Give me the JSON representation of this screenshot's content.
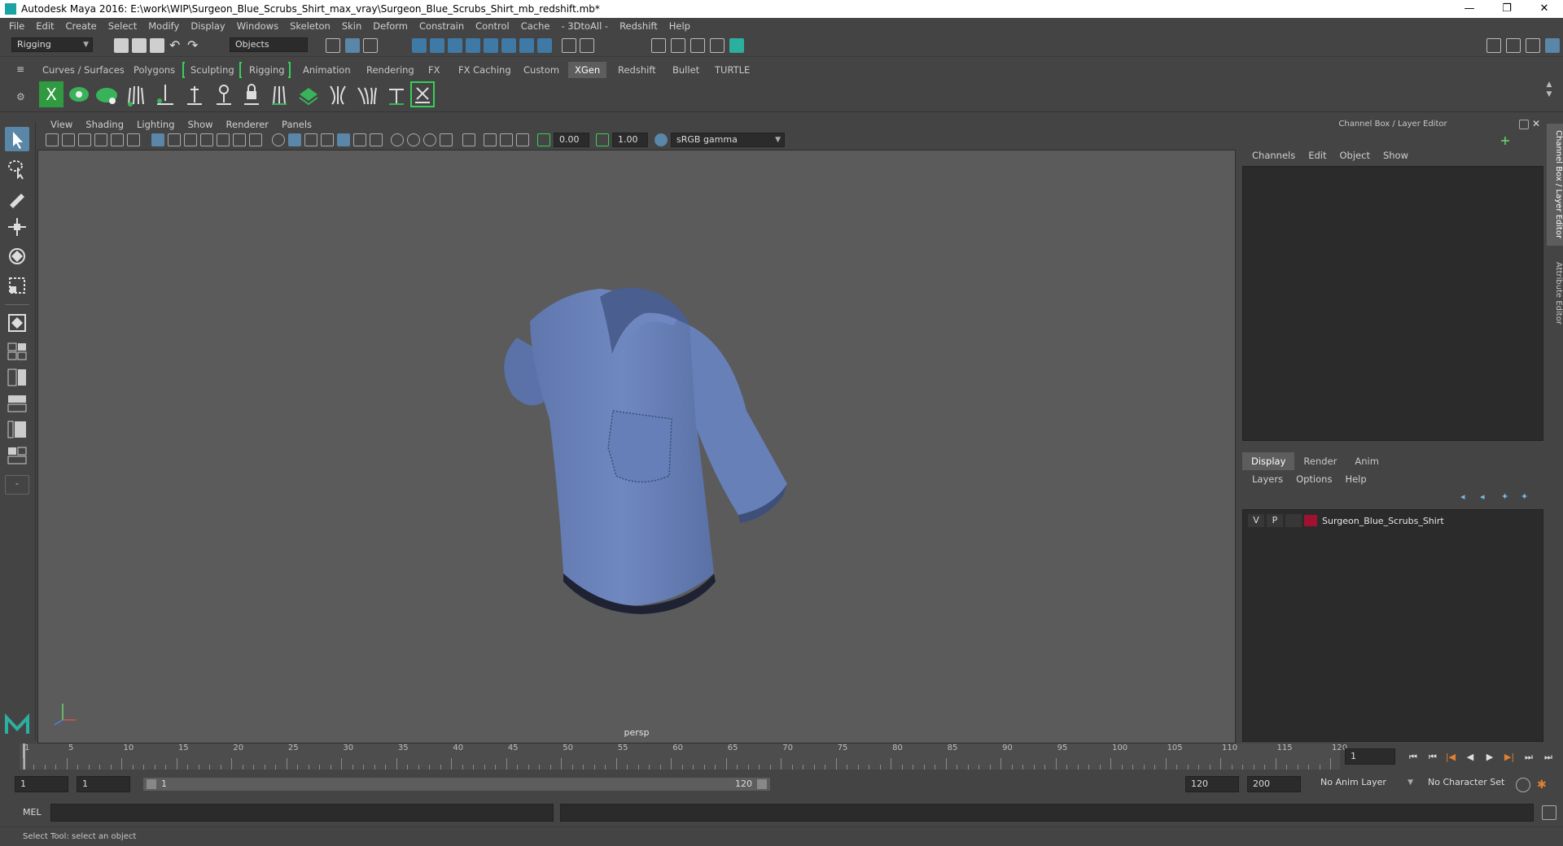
{
  "window": {
    "title": "Autodesk Maya 2016: E:\\work\\WIP\\Surgeon_Blue_Scrubs_Shirt_max_vray\\Surgeon_Blue_Scrubs_Shirt_mb_redshift.mb*",
    "minimize": "—",
    "restore": "❐",
    "close": "✕"
  },
  "menu": [
    "File",
    "Edit",
    "Create",
    "Select",
    "Modify",
    "Display",
    "Windows",
    "Skeleton",
    "Skin",
    "Deform",
    "Constrain",
    "Control",
    "Cache",
    "- 3DtoAll -",
    "Redshift",
    "Help"
  ],
  "statusline": {
    "mode": "Rigging",
    "select_mode": "Objects"
  },
  "shelf": {
    "tabs": [
      "Curves / Surfaces",
      "Polygons",
      "Sculpting",
      "Rigging",
      "Animation",
      "Rendering",
      "FX",
      "FX Caching",
      "Custom",
      "XGen",
      "Redshift",
      "Bullet",
      "TURTLE"
    ],
    "active_tab": "XGen"
  },
  "viewport": {
    "menu": [
      "View",
      "Shading",
      "Lighting",
      "Show",
      "Renderer",
      "Panels"
    ],
    "exposure": "0.00",
    "gamma": "1.00",
    "color_space": "sRGB gamma",
    "camera_label": "persp"
  },
  "channel_box": {
    "title": "Channel Box / Layer Editor",
    "menu": [
      "Channels",
      "Edit",
      "Object",
      "Show"
    ]
  },
  "layer_editor": {
    "tabs": [
      "Display",
      "Render",
      "Anim"
    ],
    "active_tab": "Display",
    "menu": [
      "Layers",
      "Options",
      "Help"
    ],
    "layers": [
      {
        "v": "V",
        "p": "P",
        "name": "Surgeon_Blue_Scrubs_Shirt",
        "color": "#a0122f"
      }
    ]
  },
  "side_tabs": [
    "Channel Box / Layer Editor",
    "Attribute Editor"
  ],
  "time_slider": {
    "ticks": [
      "1",
      "5",
      "10",
      "15",
      "20",
      "25",
      "30",
      "35",
      "40",
      "45",
      "50",
      "55",
      "60",
      "65",
      "70",
      "75",
      "80",
      "85",
      "90",
      "95",
      "100",
      "105",
      "110",
      "115",
      "120"
    ],
    "current_frame": "1"
  },
  "range_slider": {
    "start": "1",
    "playback_start": "1",
    "range_start_label": "1",
    "range_end_label": "120",
    "playback_end": "120",
    "end": "200",
    "anim_layer": "No Anim Layer",
    "character_set": "No Character Set"
  },
  "command_line": {
    "label": "MEL"
  },
  "help_line": "Select Tool: select an object",
  "colors": {
    "shirt": "#6a82b9",
    "viewport_bg": "#5b5b5b",
    "active_tab": "#5d5d5d",
    "accent_green": "#34d05a",
    "layer_color": "#a0122f"
  }
}
